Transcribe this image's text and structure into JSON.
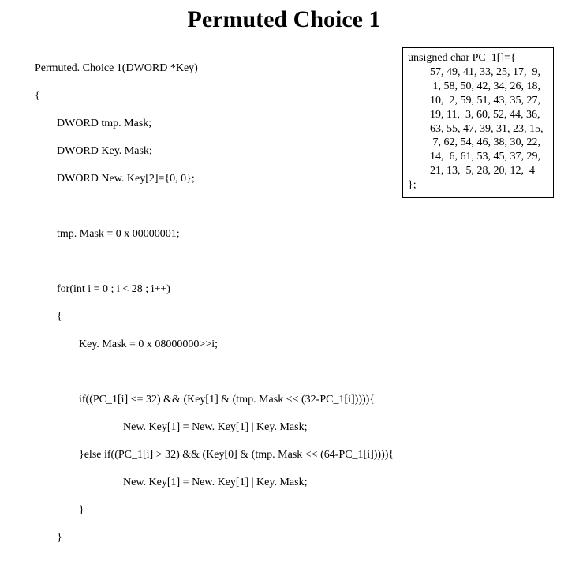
{
  "title": "Permuted Choice 1",
  "code": {
    "l1": "Permuted. Choice 1(DWORD *Key)",
    "l2": "{",
    "l3": "DWORD tmp. Mask;",
    "l4": "DWORD Key. Mask;",
    "l5": "DWORD New. Key[2]={0, 0};",
    "l6": "tmp. Mask = 0 x 00000001;",
    "l7": "for(int i = 0 ; i < 28 ; i++)",
    "l8": "{",
    "l9": "Key. Mask = 0 x 08000000>>i;",
    "l10": "if((PC_1[i] <= 32) && (Key[1] & (tmp. Mask << (32-PC_1[i])))){",
    "l11": "New. Key[1] = New. Key[1] | Key. Mask;",
    "l12": "}else if((PC_1[i] > 32) && (Key[0] & (tmp. Mask << (64-PC_1[i])))){",
    "l13": "New. Key[1] = New. Key[1] | Key. Mask;",
    "l14": "}",
    "l15": "}"
  },
  "pc1": {
    "header": "unsigned char PC_1[]={",
    "r1": "57, 49, 41, 33, 25, 17,  9,",
    "r2": " 1, 58, 50, 42, 34, 26, 18,",
    "r3": "10,  2, 59, 51, 43, 35, 27,",
    "r4": "19, 11,  3, 60, 52, 44, 36,",
    "r5": "63, 55, 47, 39, 31, 23, 15,",
    "r6": " 7, 62, 54, 46, 38, 30, 22,",
    "r7": "14,  6, 61, 53, 45, 37, 29,",
    "r8": "21, 13,  5, 28, 20, 12,  4",
    "footer": "};"
  }
}
